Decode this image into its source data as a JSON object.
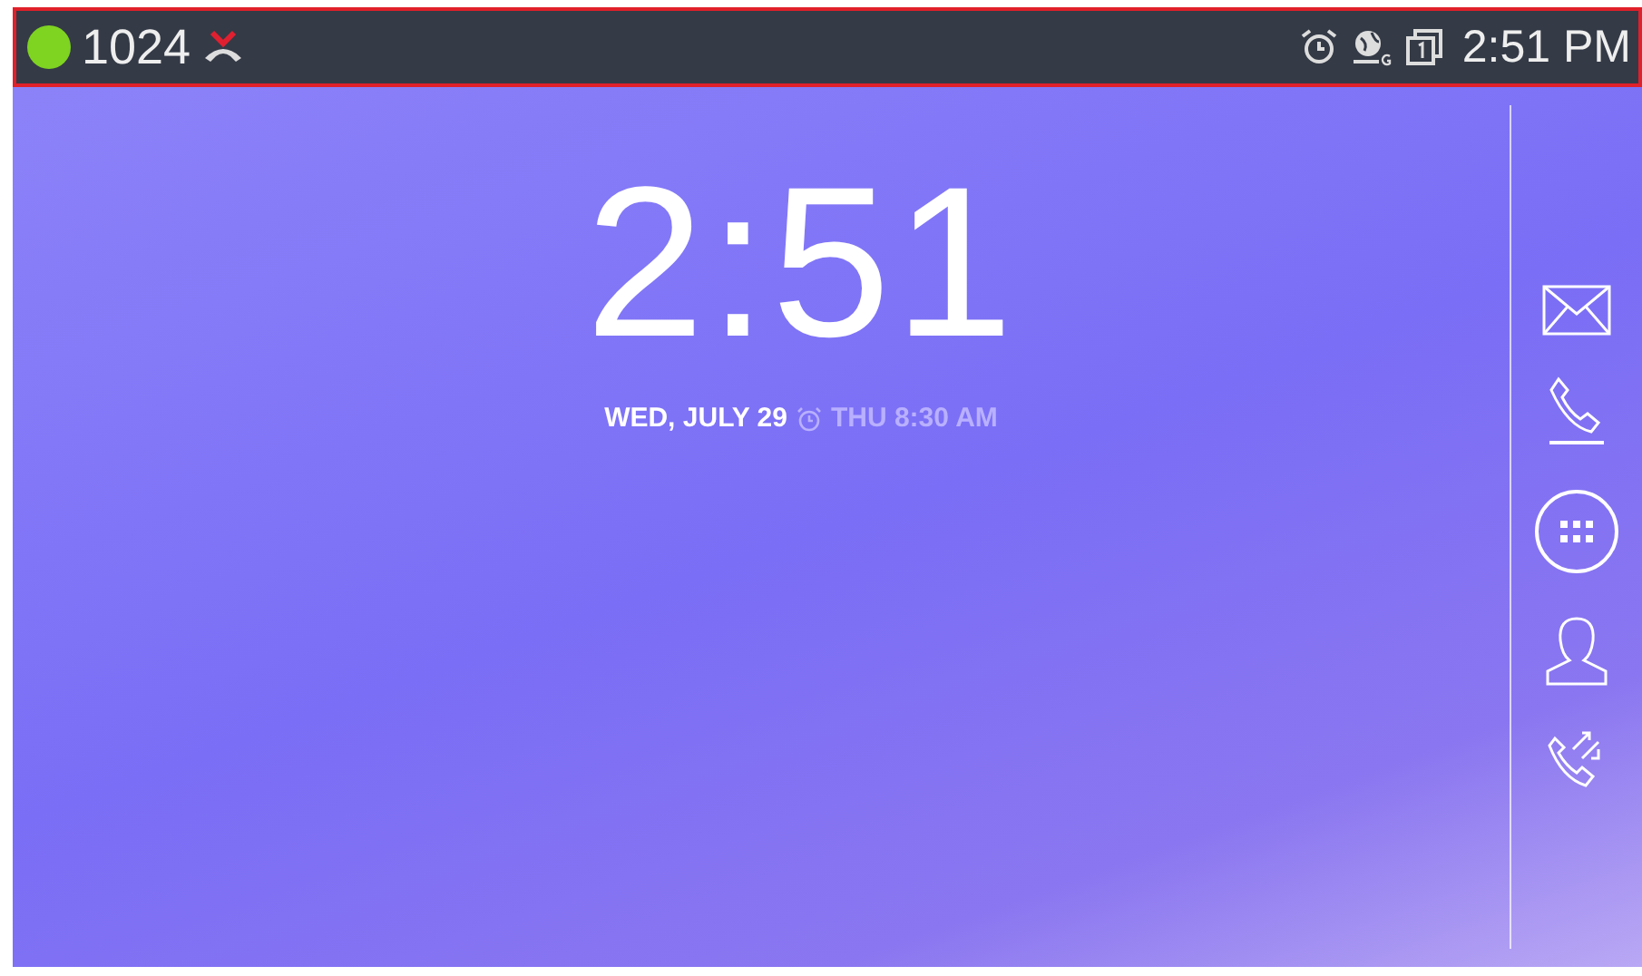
{
  "status_bar": {
    "registered": true,
    "extension": "1024",
    "time": "2:51 PM"
  },
  "clock": {
    "time": "2:51",
    "date": "WED, JULY 29",
    "alarm": "THU 8:30 AM"
  },
  "dock": [
    {
      "kind": "mail"
    },
    {
      "kind": "phone"
    },
    {
      "kind": "apps"
    },
    {
      "kind": "contact"
    },
    {
      "kind": "calls"
    }
  ]
}
